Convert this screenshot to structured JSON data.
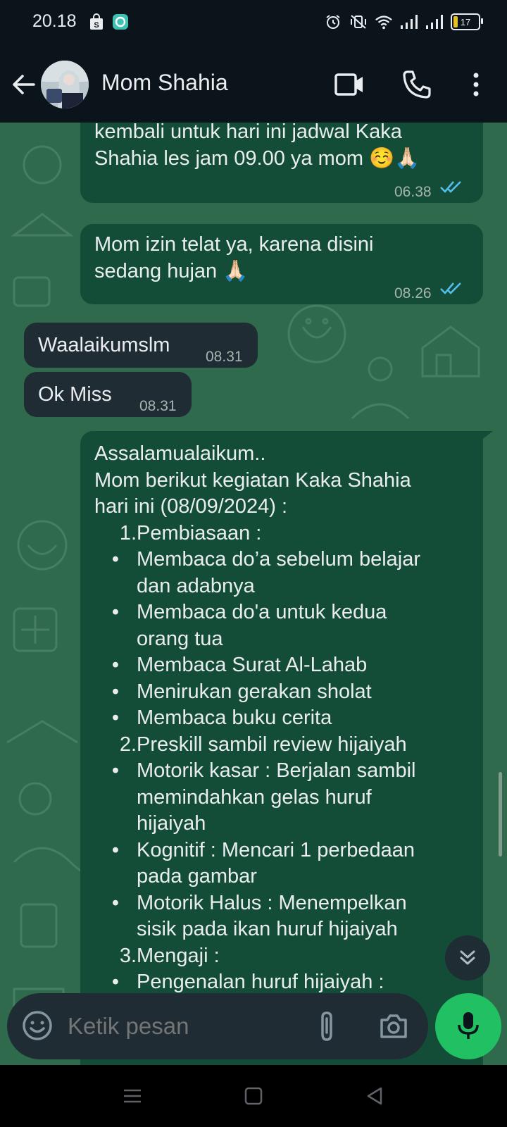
{
  "status_bar": {
    "time": "20.18",
    "battery_level": "17",
    "icons_left": [
      "shopping-bag-icon",
      "app-notification-icon"
    ],
    "icons_right": [
      "alarm-icon",
      "vibrate-off-icon",
      "wifi-icon",
      "signal-icon",
      "signal-icon",
      "battery-icon"
    ]
  },
  "header": {
    "contact_name": "Mom Shahia",
    "actions": [
      "video-call-icon",
      "voice-call-icon",
      "more-options-icon"
    ]
  },
  "messages": [
    {
      "direction": "outgoing",
      "lines": [
        "kembali untuk hari ini jadwal Kaka",
        "Shahia les jam 09.00 ya mom ☺️🙏🏻"
      ],
      "time": "06.38",
      "status": "read"
    },
    {
      "direction": "outgoing",
      "lines": [
        "Mom izin telat ya, karena disini",
        "sedang hujan 🙏🏻"
      ],
      "time": "08.26",
      "status": "read"
    },
    {
      "direction": "incoming",
      "text": "Waalaikumslm",
      "time": "08.31"
    },
    {
      "direction": "incoming",
      "text": "Ok Miss",
      "time": "08.31"
    }
  ],
  "long_message": {
    "direction": "outgoing",
    "intro": [
      "Assalamualaikum..",
      "Mom berikut kegiatan Kaka Shahia",
      "hari ini (08/09/2024) :"
    ],
    "sections": [
      {
        "number": "1.",
        "title": "Pembiasaan :",
        "items": [
          [
            "Membaca do’a sebelum belajar",
            "dan adabnya"
          ],
          [
            "Membaca do'a untuk kedua",
            "orang tua"
          ],
          [
            "Membaca Surat Al-Lahab"
          ],
          [
            "Menirukan gerakan sholat"
          ],
          [
            "Membaca buku cerita"
          ]
        ]
      },
      {
        "number": "2.",
        "title": "Preskill sambil review hijaiyah",
        "items": [
          [
            "Motorik kasar :  Berjalan sambil",
            "memindahkan gelas huruf",
            "hijaiyah"
          ],
          [
            "Kognitif :  Mencari 1 perbedaan",
            "pada gambar"
          ],
          [
            "Motorik Halus :  Menempelkan",
            "sisik pada ikan huruf hijaiyah"
          ]
        ]
      },
      {
        "number": "3.",
        "title": "Mengaji :",
        "items": [
          [
            "Pengenalan huruf hijaiyah :"
          ]
        ]
      }
    ]
  },
  "composer": {
    "placeholder": "Ketik pesan",
    "icons": [
      "emoji-icon",
      "attach-icon",
      "camera-icon",
      "mic-icon"
    ]
  },
  "colors": {
    "chat_background": "#2f6a4c",
    "outgoing_bubble": "#144d37",
    "incoming_bubble": "#202c33",
    "read_ticks": "#53bdeb",
    "mic_button": "#21c063"
  }
}
